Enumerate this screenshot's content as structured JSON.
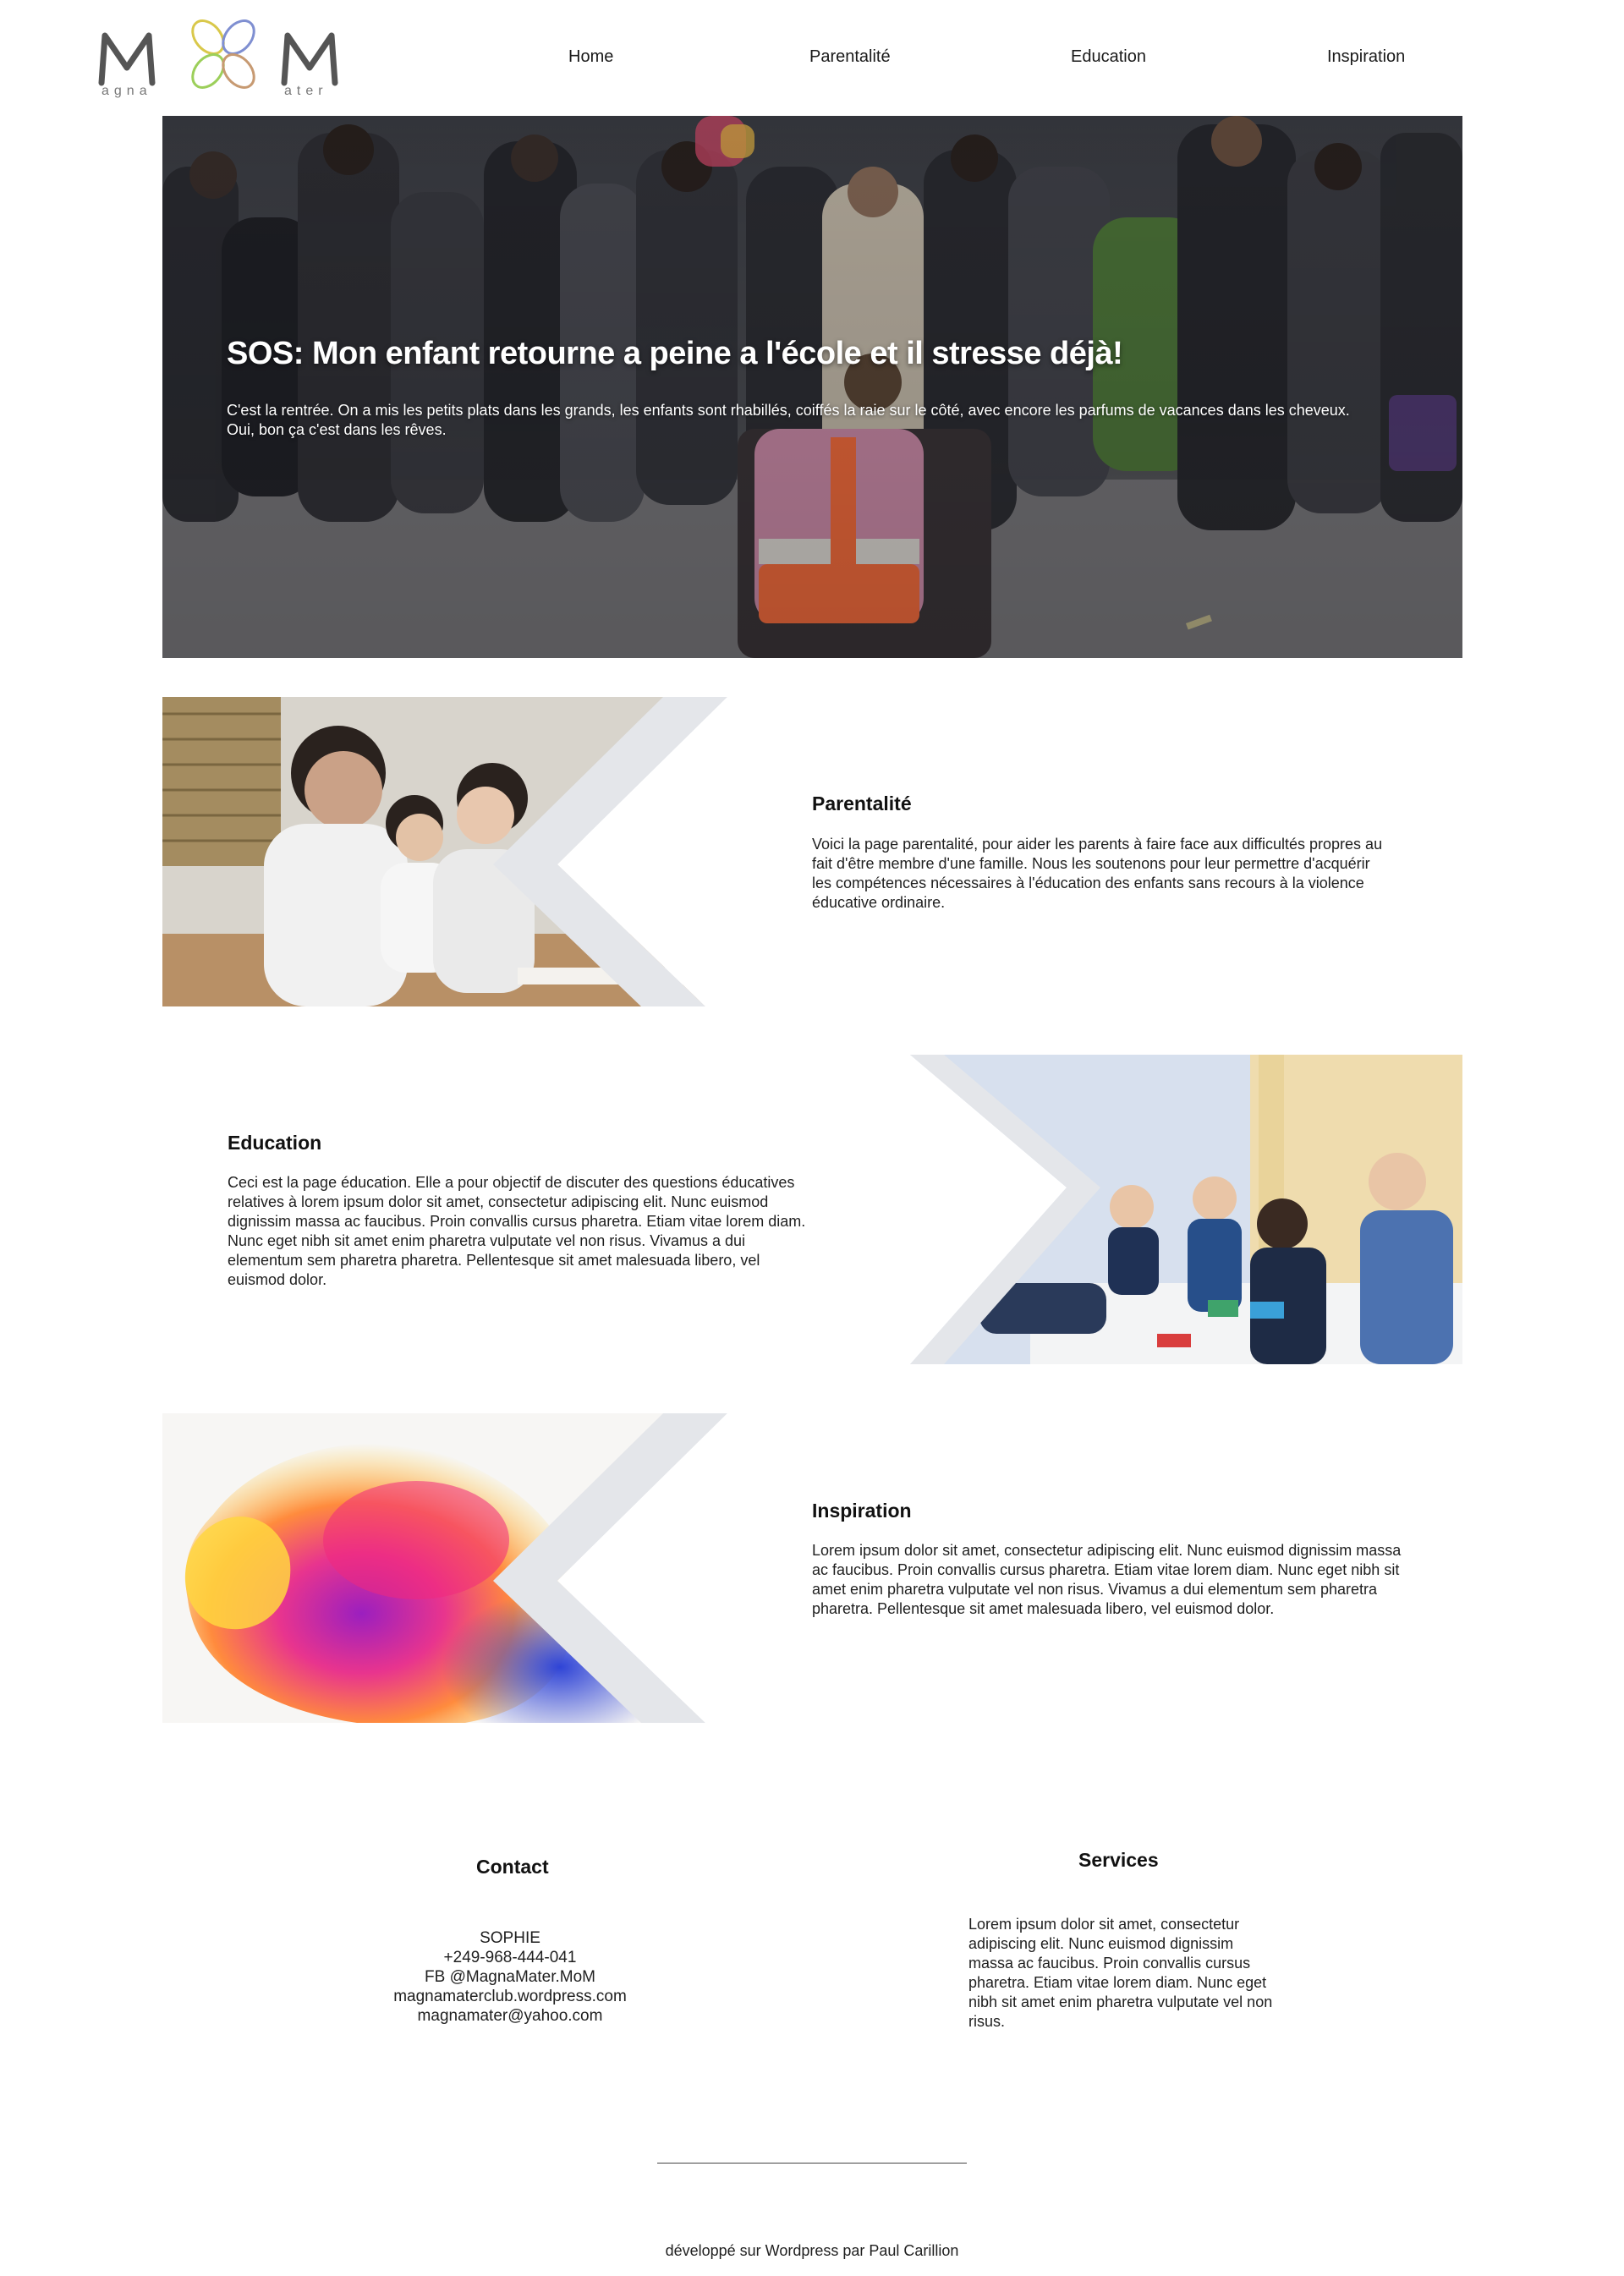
{
  "header": {
    "logo_text": "MoM",
    "logo_subtext_left": "agna",
    "logo_subtext_right": "ater",
    "nav": [
      "Home",
      "Parentalité",
      "Education",
      "Inspiration"
    ]
  },
  "hero": {
    "title": "SOS: Mon enfant retourne a peine a l'école et il stresse déjà!",
    "text": "C'est la rentrée. On a mis les petits plats dans les grands, les enfants sont rhabillés, coiffés la raie sur le côté, avec encore les parfums de vacances dans les cheveux. Oui, bon ça c'est dans les rêves."
  },
  "features": [
    {
      "title": "Parentalité",
      "text": "Voici la page parentalité, pour aider les parents à faire face aux difficultés propres au fait d'être membre d'une famille. Nous les soutenons pour leur permettre d'acquérir les compétences nécessaires à l'éducation des enfants sans recours à la violence éducative ordinaire."
    },
    {
      "title": "Education",
      "text": "Ceci est la page éducation. Elle a pour objectif de discuter des questions éducatives relatives à lorem ipsum dolor sit amet, consectetur adipiscing elit. Nunc euismod dignissim massa ac faucibus. Proin convallis cursus pharetra. Etiam vitae lorem diam. Nunc eget nibh sit amet enim pharetra vulputate vel non risus. Vivamus a dui elementum sem pharetra pharetra. Pellentesque sit amet malesuada libero, vel euismod dolor."
    },
    {
      "title": "Inspiration",
      "text": "Lorem ipsum dolor sit amet, consectetur adipiscing elit. Nunc euismod dignissim massa ac faucibus. Proin convallis cursus pharetra. Etiam vitae lorem diam. Nunc eget nibh sit amet enim pharetra vulputate vel non risus. Vivamus a dui elementum sem pharetra pharetra. Pellentesque sit amet malesuada libero, vel euismod dolor."
    }
  ],
  "footer": {
    "contact_title": "Contact",
    "contact_lines": [
      "SOPHIE",
      "+249-968-444-041",
      "FB @MagnaMater.MoM",
      "magnamaterclub.wordpress.com",
      "magnamater@yahoo.com"
    ],
    "services_title": "Services",
    "services_text": "Lorem ipsum dolor sit amet, consectetur adipiscing elit. Nunc euismod dignissim massa ac faucibus. Proin convallis cursus pharetra. Etiam vitae lorem diam. Nunc eget nibh sit amet enim pharetra vulputate vel non risus.",
    "credit": "développé sur Wordpress par Paul Carillion"
  },
  "colors": {
    "chevron": "#e4e6ea",
    "text": "#1a1a1a"
  },
  "icons": [
    "mom-logo-icon"
  ]
}
